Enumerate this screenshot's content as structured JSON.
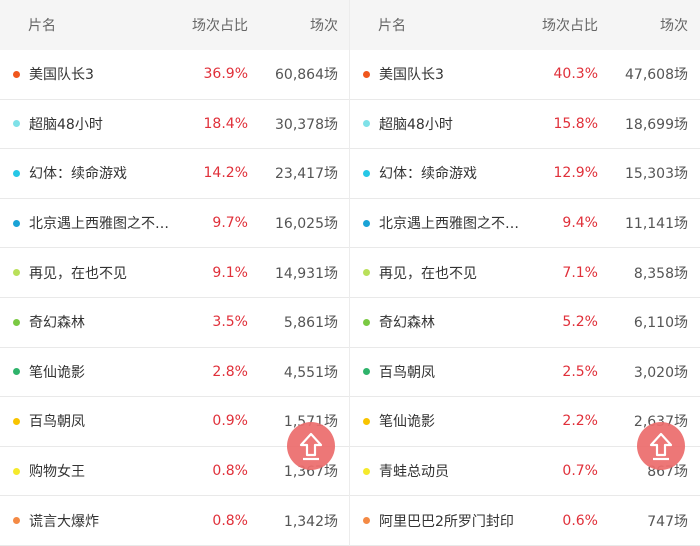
{
  "left": {
    "header": {
      "name": "片名",
      "pct": "场次占比",
      "count": "场次"
    },
    "rows": [
      {
        "name": "美国队长3",
        "pct": "36.9%",
        "count": "60,864场",
        "color": "#f0571d"
      },
      {
        "name": "超脑48小时",
        "pct": "18.4%",
        "count": "30,378场",
        "color": "#7fe1e8"
      },
      {
        "name": "幻体：续命游戏",
        "pct": "14.2%",
        "count": "23,417场",
        "color": "#26c7e6"
      },
      {
        "name": "北京遇上西雅图之不…",
        "pct": "9.7%",
        "count": "16,025场",
        "color": "#1aa3d6"
      },
      {
        "name": "再见，在也不见",
        "pct": "9.1%",
        "count": "14,931场",
        "color": "#b9e05a"
      },
      {
        "name": "奇幻森林",
        "pct": "3.5%",
        "count": "5,861场",
        "color": "#7ac943"
      },
      {
        "name": "笔仙诡影",
        "pct": "2.8%",
        "count": "4,551场",
        "color": "#2fb36b"
      },
      {
        "name": "百鸟朝凤",
        "pct": "0.9%",
        "count": "1,571场",
        "color": "#f8c400"
      },
      {
        "name": "购物女王",
        "pct": "0.8%",
        "count": "1,367场",
        "color": "#f5ea2c"
      },
      {
        "name": "谎言大爆炸",
        "pct": "0.8%",
        "count": "1,342场",
        "color": "#f48a45"
      }
    ]
  },
  "right": {
    "header": {
      "name": "片名",
      "pct": "场次占比",
      "count": "场次"
    },
    "rows": [
      {
        "name": "美国队长3",
        "pct": "40.3%",
        "count": "47,608场",
        "color": "#f0571d"
      },
      {
        "name": "超脑48小时",
        "pct": "15.8%",
        "count": "18,699场",
        "color": "#7fe1e8"
      },
      {
        "name": "幻体：续命游戏",
        "pct": "12.9%",
        "count": "15,303场",
        "color": "#26c7e6"
      },
      {
        "name": "北京遇上西雅图之不…",
        "pct": "9.4%",
        "count": "11,141场",
        "color": "#1aa3d6"
      },
      {
        "name": "再见，在也不见",
        "pct": "7.1%",
        "count": "8,358场",
        "color": "#b9e05a"
      },
      {
        "name": "奇幻森林",
        "pct": "5.2%",
        "count": "6,110场",
        "color": "#7ac943"
      },
      {
        "name": "百鸟朝凤",
        "pct": "2.5%",
        "count": "3,020场",
        "color": "#2fb36b"
      },
      {
        "name": "笔仙诡影",
        "pct": "2.2%",
        "count": "2,637场",
        "color": "#f8c400"
      },
      {
        "name": "青蛙总动员",
        "pct": "0.7%",
        "count": "867场",
        "color": "#f5ea2c"
      },
      {
        "name": "阿里巴巴2所罗门封印",
        "pct": "0.6%",
        "count": "747场",
        "color": "#f48a45"
      }
    ]
  },
  "icons": {
    "back_to_top": "arrow-up-icon"
  },
  "colors": {
    "accent": "#e0303a",
    "header_bg": "#f5f5f5",
    "button": "#ec6d6d"
  }
}
